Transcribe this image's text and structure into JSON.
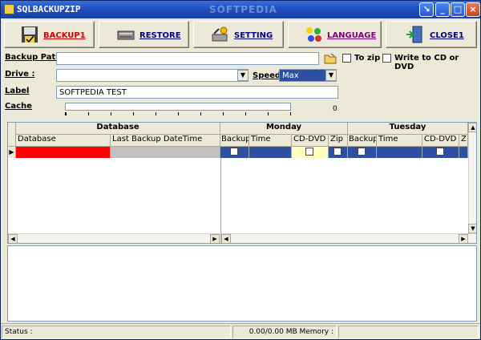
{
  "window": {
    "title": "SQLBACKUPZIP",
    "watermark": "SOFTPEDIA"
  },
  "toolbar": {
    "backup": "BACKUP1",
    "restore": "RESTORE",
    "setting": "SETTING",
    "language": "LANGUAGE",
    "close": "CLOSE1"
  },
  "form": {
    "backup_path_label": "Backup Path",
    "backup_path_value": "",
    "to_zip_label": "To zip",
    "write_cd_label": "Write to CD or DVD",
    "drive_label": "Drive :",
    "drive_value": "",
    "speed_label": "Speed",
    "speed_value": "Max",
    "label_label": "Label",
    "label_value": "SOFTPEDIA TEST",
    "cache_label": "Cache",
    "cache_value": "0"
  },
  "grid": {
    "group_database": "Database",
    "group_monday": "Monday",
    "group_tuesday": "Tuesday",
    "col_database": "Database",
    "col_last_backup": "Last Backup DateTime",
    "mon_backup": "Backup",
    "mon_time": "Time",
    "mon_cddvd": "CD-DVD",
    "mon_zip": "Zip",
    "tue_backup": "Backup",
    "tue_time": "Time",
    "tue_cddvd": "CD-DVD",
    "tue_z": "Z"
  },
  "status": {
    "status_label": "Status :",
    "memory_text": "0.00/0.00 MB Memory :"
  },
  "colors": {
    "title_bar": "#1f4fbf",
    "selected_row": "#2f4fa0",
    "database_cell": "#ff0000",
    "last_backup_cell": "#c0c0c0",
    "highlight_cell": "#ffffc0"
  }
}
